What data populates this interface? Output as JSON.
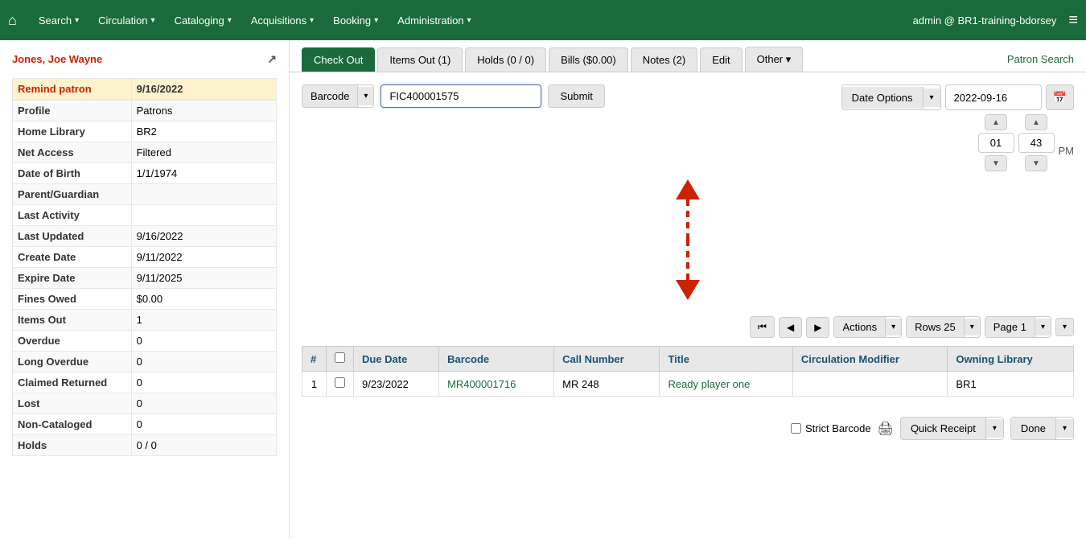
{
  "nav": {
    "home_icon": "⌂",
    "items": [
      {
        "label": "Search",
        "caret": "▾"
      },
      {
        "label": "Circulation",
        "caret": "▾"
      },
      {
        "label": "Cataloging",
        "caret": "▾"
      },
      {
        "label": "Acquisitions",
        "caret": "▾"
      },
      {
        "label": "Booking",
        "caret": "▾"
      },
      {
        "label": "Administration",
        "caret": "▾"
      }
    ],
    "user": "admin @ BR1-training-bdorsey",
    "menu_icon": "≡"
  },
  "patron": {
    "name": "Jones, Joe Wayne",
    "link_icon": "↗",
    "remind_label": "Remind patron",
    "remind_date": "9/16/2022",
    "fields": [
      {
        "label": "Profile",
        "value": "Patrons"
      },
      {
        "label": "Home Library",
        "value": "BR2"
      },
      {
        "label": "Net Access",
        "value": "Filtered"
      },
      {
        "label": "Date of Birth",
        "value": "1/1/1974"
      },
      {
        "label": "Parent/Guardian",
        "value": ""
      },
      {
        "label": "Last Activity",
        "value": ""
      },
      {
        "label": "Last Updated",
        "value": "9/16/2022"
      },
      {
        "label": "Create Date",
        "value": "9/11/2022"
      },
      {
        "label": "Expire Date",
        "value": "9/11/2025"
      },
      {
        "label": "Fines Owed",
        "value": "$0.00"
      },
      {
        "label": "Items Out",
        "value": "1"
      },
      {
        "label": "Overdue",
        "value": "0"
      },
      {
        "label": "Long Overdue",
        "value": "0"
      },
      {
        "label": "Claimed Returned",
        "value": "0"
      },
      {
        "label": "Lost",
        "value": "0"
      },
      {
        "label": "Non-Cataloged",
        "value": "0"
      },
      {
        "label": "Holds",
        "value": "0 / 0"
      }
    ]
  },
  "tabs": [
    {
      "label": "Check Out",
      "active": true
    },
    {
      "label": "Items Out (1)",
      "active": false
    },
    {
      "label": "Holds (0 / 0)",
      "active": false
    },
    {
      "label": "Bills ($0.00)",
      "active": false
    },
    {
      "label": "Notes (2)",
      "active": false
    },
    {
      "label": "Edit",
      "active": false
    },
    {
      "label": "Other",
      "active": false,
      "caret": "▾"
    }
  ],
  "patron_search_label": "Patron Search",
  "checkout": {
    "barcode_label": "Barcode",
    "barcode_caret": "▾",
    "barcode_value": "FIC400001575",
    "submit_label": "Submit",
    "date_options_label": "Date Options",
    "date_options_caret": "▾",
    "date_value": "2022-09-16",
    "calendar_icon": "📅",
    "time_hour": "01",
    "time_minute": "43",
    "time_ampm": "PM",
    "up_arrow": "▲",
    "down_arrow": "▼"
  },
  "pagination": {
    "first_icon": "⏮",
    "prev_icon": "◀",
    "next_icon": "▶",
    "actions_label": "Actions",
    "actions_caret": "▾",
    "rows_label": "Rows 25",
    "rows_caret": "▾",
    "page_label": "Page 1",
    "page_caret": "▾",
    "page_down": "▾"
  },
  "table": {
    "headers": [
      "#",
      "",
      "Due Date",
      "Barcode",
      "Call Number",
      "Title",
      "Circulation Modifier",
      "Owning Library"
    ],
    "rows": [
      {
        "num": "1",
        "checked": false,
        "due_date": "9/23/2022",
        "barcode": "MR400001716",
        "call_number": "MR 248",
        "title": "Ready player one",
        "circ_modifier": "",
        "owning_library": "BR1"
      }
    ]
  },
  "bottom": {
    "strict_barcode_label": "Strict Barcode",
    "printer_icon": "🖨",
    "quick_receipt_label": "Quick Receipt",
    "quick_receipt_caret": "▾",
    "done_label": "Done",
    "done_caret": "▾"
  }
}
